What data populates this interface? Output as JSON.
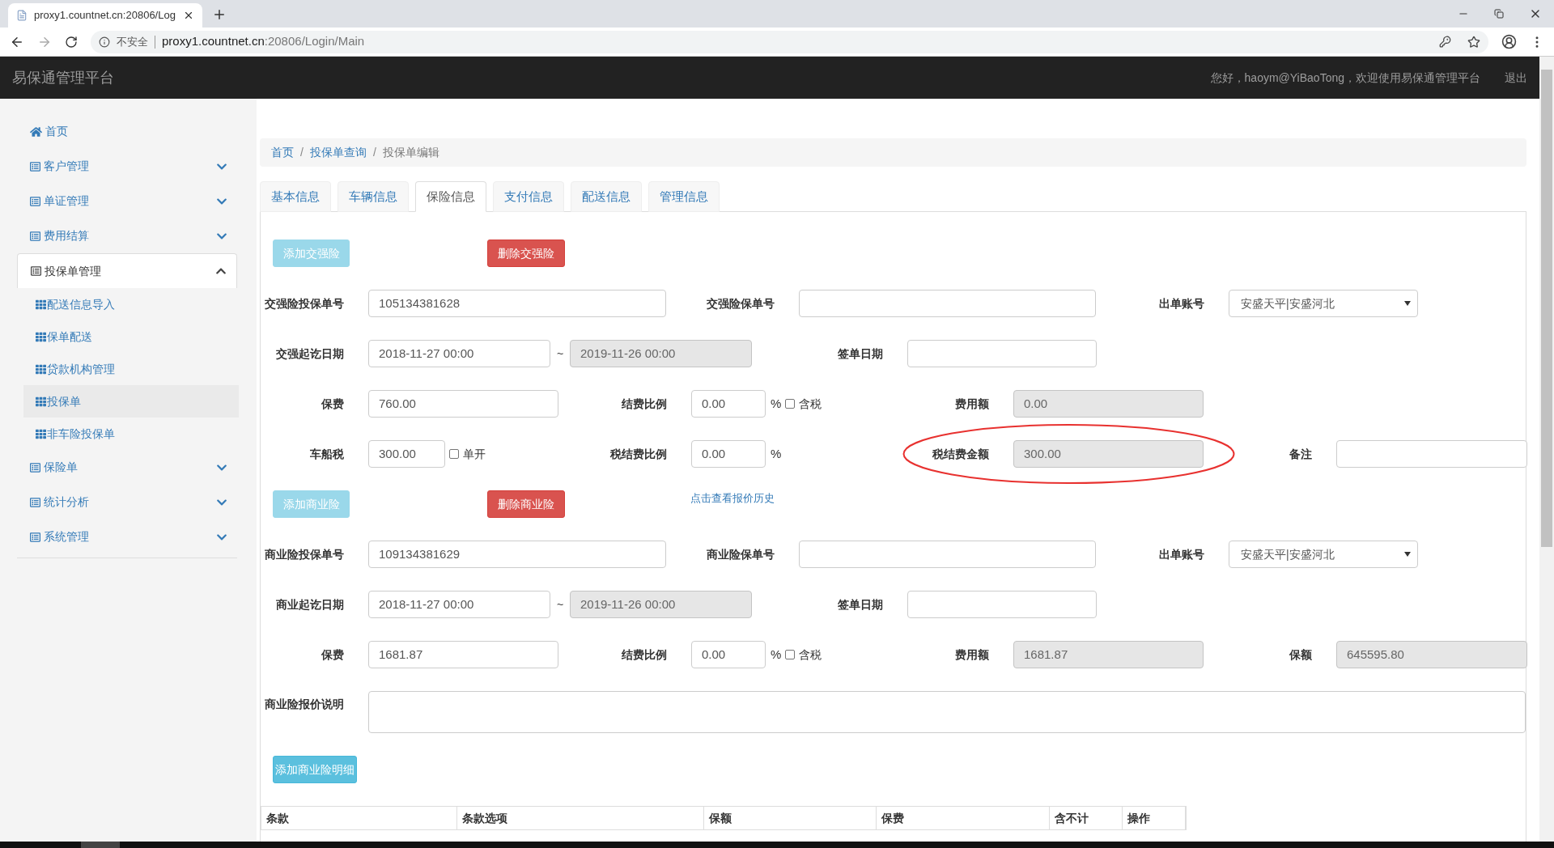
{
  "browser": {
    "tab_title": "proxy1.countnet.cn:20806/Log",
    "security": "不安全",
    "url_host": "proxy1.countnet.cn",
    "url_path": ":20806/Login/Main"
  },
  "navbar": {
    "title": "易保通管理平台",
    "greeting": "您好，haoym@YiBaoTong，欢迎使用易保通管理平台",
    "logout": "退出"
  },
  "sidebar": {
    "items": [
      {
        "label": "首页",
        "kind": "home"
      },
      {
        "label": "客户管理",
        "kind": "group",
        "expanded": false
      },
      {
        "label": "单证管理",
        "kind": "group",
        "expanded": false
      },
      {
        "label": "费用结算",
        "kind": "group",
        "expanded": false
      },
      {
        "label": "投保单管理",
        "kind": "group",
        "expanded": true,
        "children": [
          {
            "label": "配送信息导入",
            "selected": false
          },
          {
            "label": "保单配送",
            "selected": false
          },
          {
            "label": "贷款机构管理",
            "selected": false
          },
          {
            "label": "投保单",
            "selected": true
          },
          {
            "label": "非车险投保单",
            "selected": false
          }
        ]
      },
      {
        "label": "保险单",
        "kind": "group",
        "expanded": false
      },
      {
        "label": "统计分析",
        "kind": "group",
        "expanded": false
      },
      {
        "label": "系统管理",
        "kind": "group",
        "expanded": false
      }
    ]
  },
  "breadcrumb": {
    "separator": "/",
    "items": [
      "首页",
      "投保单查询",
      "投保单编辑"
    ]
  },
  "tabs": [
    {
      "label": "基本信息",
      "selected": false
    },
    {
      "label": "车辆信息",
      "selected": false
    },
    {
      "label": "保险信息",
      "selected": true
    },
    {
      "label": "支付信息",
      "selected": false
    },
    {
      "label": "配送信息",
      "selected": false
    },
    {
      "label": "管理信息",
      "selected": false
    }
  ],
  "compulsory": {
    "add_button": {
      "label": "添加交强险",
      "disabled": true
    },
    "delete_button": {
      "label": "删除交强险"
    },
    "rows": [
      {
        "fields": [
          {
            "label": "交强险投保单号",
            "kind": "input",
            "value": "105134381628",
            "readonly": false
          },
          {
            "label": "交强险保单号",
            "kind": "input",
            "readonly": false
          },
          {
            "label": "出单账号",
            "kind": "select",
            "value": "安盛天平|安盛河北"
          }
        ]
      },
      {
        "fields": [
          {
            "label": "交强起讫日期",
            "kind": "range",
            "from": "2018-11-27 00:00",
            "separator": "~",
            "to": "2019-11-26 00:00"
          },
          {
            "label": "签单日期",
            "kind": "input",
            "readonly": false
          }
        ]
      },
      {
        "fields": [
          {
            "label": "保费",
            "kind": "input",
            "value": "760.00",
            "readonly": false
          },
          {
            "label": "结费比例",
            "kind": "percent",
            "value": "0.00",
            "unit": "%",
            "checkbox": {
              "label": "含税",
              "checked": false
            }
          },
          {
            "label": "费用额",
            "kind": "input",
            "value": "0.00",
            "readonly": true
          }
        ]
      },
      {
        "fields": [
          {
            "label": "车船税",
            "kind": "input_check",
            "value": "300.00",
            "checkbox": {
              "label": "单开",
              "checked": false
            }
          },
          {
            "label": "税结费比例",
            "kind": "percent",
            "value": "0.00",
            "unit": "%"
          },
          {
            "label": "税结费金额",
            "kind": "input",
            "value": "300.00",
            "readonly": true,
            "circled": true
          },
          {
            "label": "备注",
            "kind": "input",
            "readonly": false
          }
        ]
      }
    ]
  },
  "commercial": {
    "add_button": {
      "label": "添加商业险",
      "disabled": true
    },
    "delete_button": {
      "label": "删除商业险"
    },
    "history_link": "点击查看报价历史",
    "rows": [
      {
        "fields": [
          {
            "label": "商业险投保单号",
            "kind": "input",
            "value": "109134381629",
            "readonly": false
          },
          {
            "label": "商业险保单号",
            "kind": "input",
            "readonly": false
          },
          {
            "label": "出单账号",
            "kind": "select",
            "value": "安盛天平|安盛河北"
          }
        ]
      },
      {
        "fields": [
          {
            "label": "商业起讫日期",
            "kind": "range",
            "from": "2018-11-27 00:00",
            "separator": "~",
            "to": "2019-11-26 00:00"
          },
          {
            "label": "签单日期",
            "kind": "input",
            "readonly": false
          }
        ]
      },
      {
        "fields": [
          {
            "label": "保费",
            "kind": "input",
            "value": "1681.87",
            "readonly": false
          },
          {
            "label": "结费比例",
            "kind": "percent",
            "value": "0.00",
            "unit": "%",
            "checkbox": {
              "label": "含税",
              "checked": false
            }
          },
          {
            "label": "费用额",
            "kind": "input",
            "value": "1681.87",
            "readonly": true
          },
          {
            "label": "保额",
            "kind": "input",
            "value": "645595.80",
            "readonly": true
          }
        ]
      }
    ],
    "note_label": "商业险报价说明",
    "detail_button": {
      "label": "添加商业险明细",
      "disabled": false
    }
  },
  "table": {
    "columns": [
      "条款",
      "条款选项",
      "保额",
      "保费",
      "含不计",
      "操作"
    ]
  }
}
